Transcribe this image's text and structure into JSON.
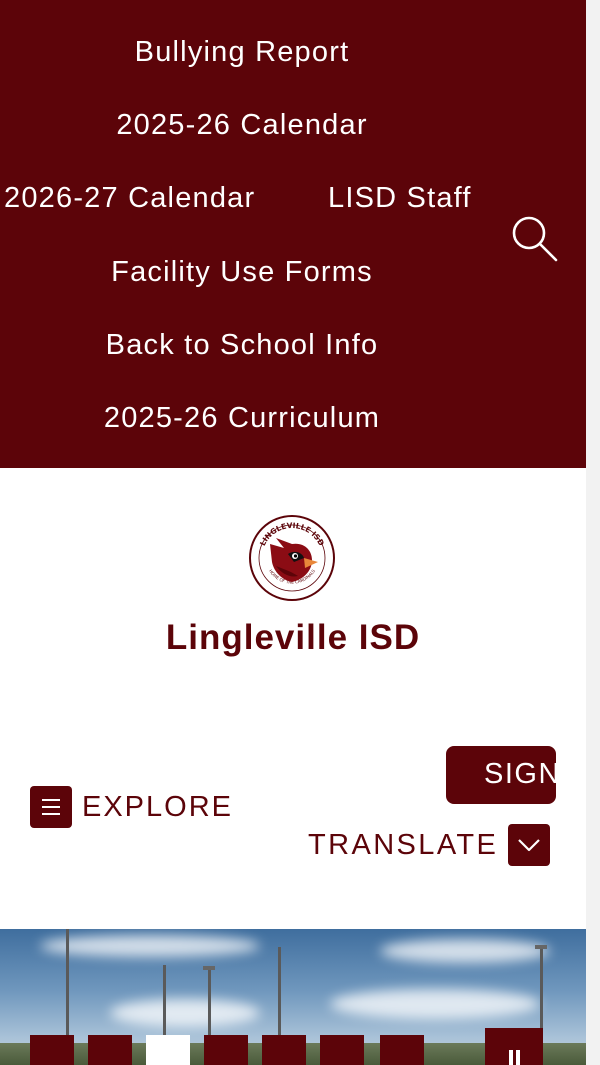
{
  "quick_links": [
    {
      "label": "Bullying Report"
    },
    {
      "label": "2025-26 Calendar"
    },
    {
      "label": "2026-27 Calendar"
    },
    {
      "label": "LISD Staff"
    },
    {
      "label": "Facility Use Forms"
    },
    {
      "label": "Back to School Info"
    },
    {
      "label": "2025-26 Curriculum"
    }
  ],
  "search": {
    "icon": "search-icon"
  },
  "brand": {
    "name": "Lingleville ISD",
    "logo_text": "LINGLEVILLE ISD",
    "logo_subtext": "HOME OF THE CARDINALS"
  },
  "utility": {
    "explore_label": "EXPLORE",
    "sign_in_label": "SIGN",
    "translate_label": "TRANSLATE"
  },
  "slideshow": {
    "slide_count": 7,
    "active_slide": 3
  },
  "colors": {
    "primary": "#5c0409",
    "background": "#ffffff"
  }
}
